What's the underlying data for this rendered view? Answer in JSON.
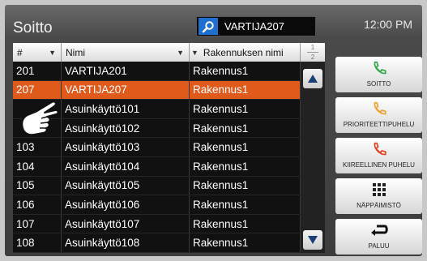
{
  "header": {
    "title": "Soitto",
    "time": "12:00 PM"
  },
  "search": {
    "icon": "search-icon",
    "value": "VARTIJA207"
  },
  "table": {
    "columns": [
      "#",
      "Nimi",
      "Rakennuksen nimi"
    ],
    "rows": [
      {
        "num": "201",
        "name": "VARTIJA201",
        "building": "Rakennus1"
      },
      {
        "num": "207",
        "name": "VARTIJA207",
        "building": "Rakennus1",
        "selected": true
      },
      {
        "num": "",
        "name": "Asuinkäyttö101",
        "building": "Rakennus1"
      },
      {
        "num": "",
        "name": "Asuinkäyttö102",
        "building": "Rakennus1"
      },
      {
        "num": "103",
        "name": "Asuinkäyttö103",
        "building": "Rakennus1"
      },
      {
        "num": "104",
        "name": "Asuinkäyttö104",
        "building": "Rakennus1"
      },
      {
        "num": "105",
        "name": "Asuinkäyttö105",
        "building": "Rakennus1"
      },
      {
        "num": "106",
        "name": "Asuinkäyttö106",
        "building": "Rakennus1"
      },
      {
        "num": "107",
        "name": "Asuinkäyttö107",
        "building": "Rakennus1"
      },
      {
        "num": "108",
        "name": "Asuinkäyttö108",
        "building": "Rakennus1"
      }
    ],
    "selected_color": "#e05a1c"
  },
  "pager": {
    "current": "1",
    "total": "2"
  },
  "actions": [
    {
      "label": "SOITTO",
      "icon": "phone-icon",
      "icon_color": "#2fa84a"
    },
    {
      "label": "PRIORITEETTIPUHELU",
      "icon": "priority-phone-icon",
      "icon_color": "#f0a030"
    },
    {
      "label": "KIIREELLINEN PUHELU",
      "icon": "urgent-phone-icon",
      "icon_color": "#e04020"
    },
    {
      "label": "NÄPPÄIMISTÖ",
      "icon": "keypad-icon",
      "icon_color": "#222222"
    },
    {
      "label": "PALUU",
      "icon": "return-icon",
      "icon_color": "#111111"
    }
  ]
}
